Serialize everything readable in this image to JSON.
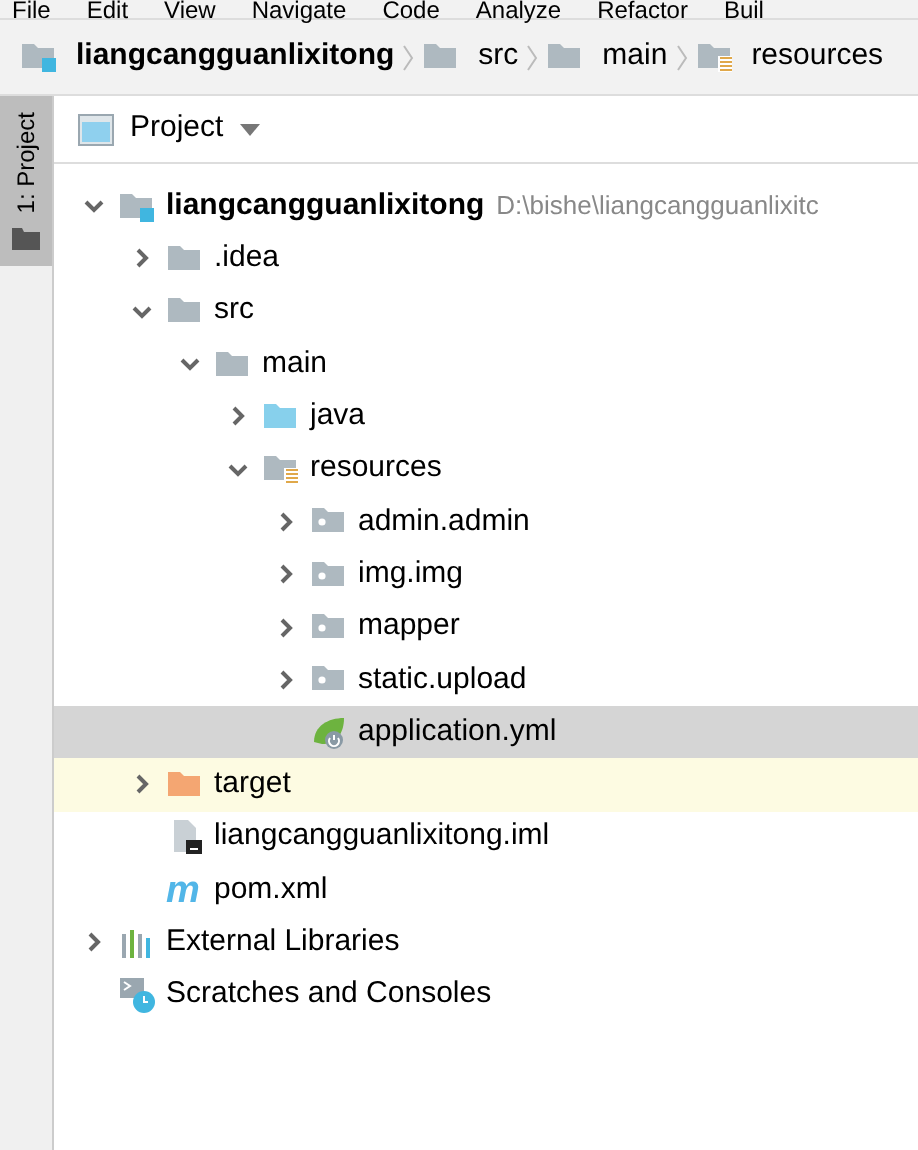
{
  "menu": [
    "File",
    "Edit",
    "View",
    "Navigate",
    "Code",
    "Analyze",
    "Refactor",
    "Buil"
  ],
  "breadcrumb": [
    {
      "label": "liangcangguanlixitong",
      "kind": "module"
    },
    {
      "label": "src",
      "kind": "folder"
    },
    {
      "label": "main",
      "kind": "folder"
    },
    {
      "label": "resources",
      "kind": "resource-folder"
    }
  ],
  "side_tab": {
    "label": "1: Project",
    "selected": true
  },
  "panel": {
    "title": "Project"
  },
  "tree": [
    {
      "label": "liangcangguanlixitong",
      "kind": "module",
      "path": "D:\\bishe\\liangcangguanlixitc",
      "expanded": true,
      "selected": false,
      "children": [
        {
          "label": ".idea",
          "kind": "folder",
          "expanded": false,
          "selected": false
        },
        {
          "label": "src",
          "kind": "folder",
          "expanded": true,
          "selected": false,
          "children": [
            {
              "label": "main",
              "kind": "folder",
              "expanded": true,
              "selected": false,
              "children": [
                {
                  "label": "java",
                  "kind": "source-folder",
                  "expanded": false,
                  "selected": false
                },
                {
                  "label": "resources",
                  "kind": "resource-folder",
                  "expanded": true,
                  "selected": false,
                  "children": [
                    {
                      "label": "admin.admin",
                      "kind": "package",
                      "expanded": false,
                      "selected": false
                    },
                    {
                      "label": "img.img",
                      "kind": "package",
                      "expanded": false,
                      "selected": false
                    },
                    {
                      "label": "mapper",
                      "kind": "package",
                      "expanded": false,
                      "selected": false
                    },
                    {
                      "label": "static.upload",
                      "kind": "package",
                      "expanded": false,
                      "selected": false
                    },
                    {
                      "label": "application.yml",
                      "kind": "spring-file",
                      "selected": true
                    }
                  ]
                }
              ]
            }
          ]
        },
        {
          "label": "target",
          "kind": "excluded-folder",
          "expanded": false,
          "selected": false,
          "highlighted": true
        },
        {
          "label": "liangcangguanlixitong.iml",
          "kind": "iml-file",
          "selected": false
        },
        {
          "label": "pom.xml",
          "kind": "maven-file",
          "glyph": "m",
          "selected": false
        }
      ]
    },
    {
      "label": "External Libraries",
      "kind": "libraries",
      "expanded": false,
      "selected": false
    },
    {
      "label": "Scratches and Consoles",
      "kind": "scratches",
      "selected": false
    }
  ]
}
